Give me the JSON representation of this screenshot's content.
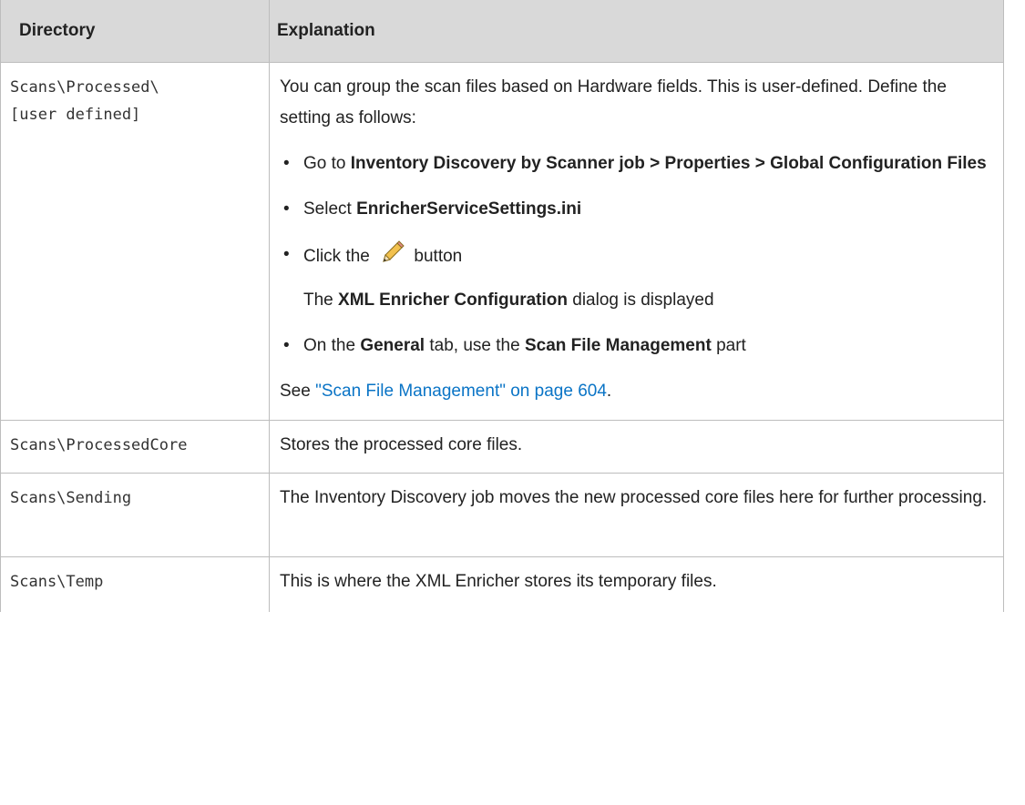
{
  "table": {
    "headers": [
      "Directory",
      "Explanation"
    ],
    "rows": [
      {
        "path_line1": "Scans\\Processed\\",
        "path_line2": "[user defined]",
        "intro": "You can group the scan files based on Hardware fields. This is user-defined. Define the setting as follows:",
        "bullets": {
          "b1_pre": "Go to ",
          "b1_bold": "Inventory Discovery by Scanner job > Properties > Global Configuration Files",
          "b2_pre": "Select ",
          "b2_bold": "EnricherServiceSettings.ini",
          "b3_pre": "Click the ",
          "b3_post": " button",
          "b3_sub_pre": "The ",
          "b3_sub_bold": "XML Enricher Configuration",
          "b3_sub_post": " dialog is displayed",
          "b4_pre": "On the ",
          "b4_bold1": "General",
          "b4_mid": " tab, use the ",
          "b4_bold2": "Scan File Management",
          "b4_post": " part"
        },
        "see_pre": "See ",
        "see_link": "\"Scan File Management\" on page 604",
        "see_post": "."
      },
      {
        "path": "Scans\\ProcessedCore",
        "text": "Stores the processed core files."
      },
      {
        "path": "Scans\\Sending",
        "text": "The Inventory Discovery job moves the new processed core files here for further processing."
      },
      {
        "path": "Scans\\Temp",
        "text": "This is where the XML Enricher stores its temporary files."
      }
    ]
  },
  "icons": {
    "edit": "pencil-icon"
  },
  "colors": {
    "header_bg": "#d9d9d9",
    "link": "#0a74c6",
    "border": "#bdbdbd"
  }
}
